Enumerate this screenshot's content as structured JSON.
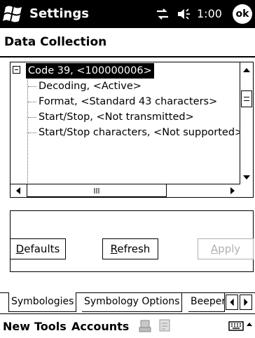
{
  "titlebar": {
    "app_title": "Settings",
    "clock": "1:00",
    "ok_label": "ok",
    "icons": [
      "windows-start-icon",
      "connectivity-icon",
      "speaker-icon"
    ]
  },
  "page": {
    "title": "Data Collection"
  },
  "tree": {
    "root": "Code 39, <100000006>",
    "children": [
      "Decoding, <Active>",
      "Format, <Standard 43 characters>",
      "Start/Stop, <Not transmitted>",
      "Start/Stop characters, <Not supported>"
    ],
    "scrollbar_grip": "III"
  },
  "buttons": {
    "defaults_first": "D",
    "defaults_rest": "efaults",
    "refresh_first": "R",
    "refresh_rest": "efresh",
    "apply_first": "A",
    "apply_rest": "pply"
  },
  "tabs": {
    "items": [
      "Symbologies",
      "Symbology Options",
      "Beeper"
    ],
    "active": "Symbologies"
  },
  "menubar": {
    "items": [
      "New",
      "Tools",
      "Accounts"
    ],
    "icons": [
      "inbox-icon",
      "compose-icon",
      "keyboard-icon"
    ]
  },
  "colors": {
    "titlebar_bg": "#000000",
    "disabled_text": "#b0b0b0"
  }
}
